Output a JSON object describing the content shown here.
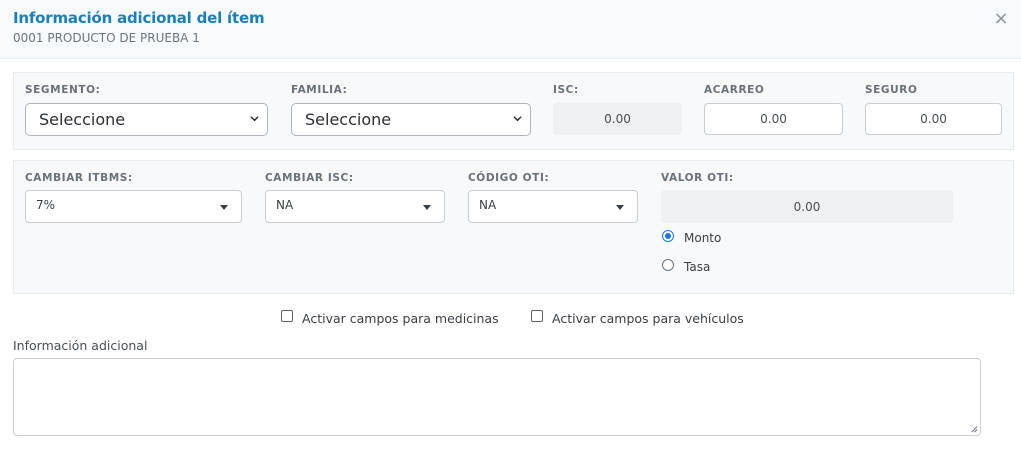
{
  "header": {
    "title": "Información adicional del ítem",
    "subtitle": "0001 PRODUCTO DE PRUEBA 1",
    "close_glyph": "×",
    "close_icon": "close-icon"
  },
  "row1": {
    "segmento": {
      "label": "SEGMENTO:",
      "value": "Seleccione"
    },
    "familia": {
      "label": "FAMILIA:",
      "value": "Seleccione"
    },
    "isc": {
      "label": "ISC:",
      "value": "0.00"
    },
    "acarreo": {
      "label": "ACARREO",
      "value": "0.00"
    },
    "seguro": {
      "label": "SEGURO",
      "value": "0.00"
    }
  },
  "row2": {
    "cambiar_itbms": {
      "label": "CAMBIAR ITBMS:",
      "value": "7%"
    },
    "cambiar_isc": {
      "label": "CAMBIAR ISC:",
      "value": "NA"
    },
    "codigo_oti": {
      "label": "CÓDIGO OTI:",
      "value": "NA"
    },
    "valor_oti": {
      "label": "VALOR OTI:",
      "value": "0.00"
    },
    "radio_monto": {
      "label": "Monto",
      "selected": true
    },
    "radio_tasa": {
      "label": "Tasa",
      "selected": false
    }
  },
  "checkboxes": {
    "medicinas": {
      "label": "Activar campos para medicinas",
      "checked": false
    },
    "vehiculos": {
      "label": "Activar campos para vehículos",
      "checked": false
    }
  },
  "info_adicional": {
    "label": "Información adicional",
    "value": ""
  },
  "colors": {
    "accent": "#1d7fb8",
    "radio": "#1a73e8"
  }
}
